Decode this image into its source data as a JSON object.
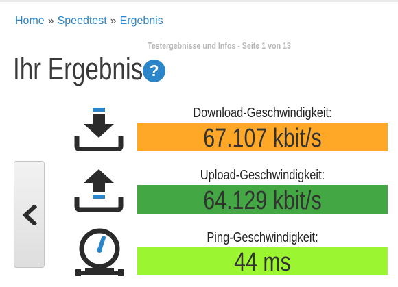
{
  "breadcrumb": {
    "items": [
      "Home",
      "Speedtest",
      "Ergebnis"
    ],
    "separator": "»"
  },
  "subtitle": "Testergebnisse und Infos - Seite 1 von 13",
  "page_title": "Ihr Ergebnis",
  "help_icon": {
    "glyph": "?",
    "name": "question-icon",
    "color": "#2a86c8"
  },
  "back_button": {
    "icon": "chevron-left-icon"
  },
  "metrics": [
    {
      "label": "Download-Geschwindigkeit:",
      "value": "67.107 kbit/s",
      "color": "#ffa726",
      "icon": "download-icon"
    },
    {
      "label": "Upload-Geschwindigkeit:",
      "value": "64.129 kbit/s",
      "color": "#43a843",
      "icon": "upload-icon"
    },
    {
      "label": "Ping-Geschwindigkeit:",
      "value": "44 ms",
      "color": "#9cf531",
      "icon": "speedometer-icon"
    }
  ],
  "colors": {
    "link": "#2a86c8",
    "icon_dark": "#2b2b2b",
    "icon_accent": "#2a86c8"
  }
}
